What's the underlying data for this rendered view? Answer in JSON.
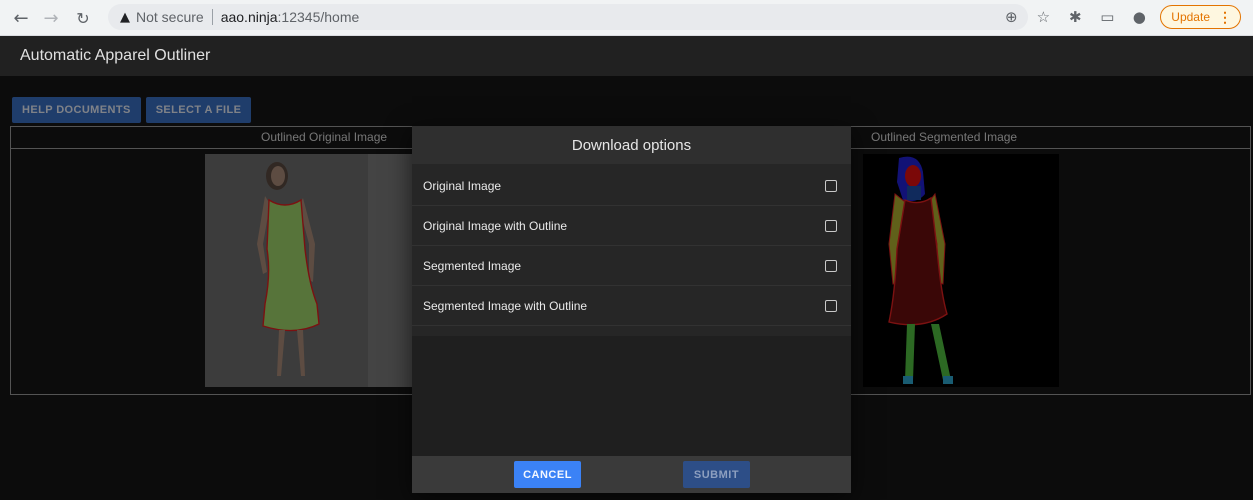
{
  "browser": {
    "security_label": "Not secure",
    "url_host": "aao.ninja",
    "url_path": ":12345/home",
    "update_label": "Update",
    "icons": [
      "back-arrow-icon",
      "forward-arrow-icon",
      "reload-icon",
      "warning-icon",
      "zoom-icon",
      "star-icon",
      "extensions-icon",
      "cast-icon",
      "profile-icon",
      "menu-dots-icon"
    ]
  },
  "app": {
    "title": "Automatic Apparel Outliner"
  },
  "toolbar": {
    "help_label": "HELP DOCUMENTS",
    "select_label": "SELECT A FILE"
  },
  "table": {
    "col_left": "Outlined Original Image",
    "col_right": "Outlined Segmented Image"
  },
  "dialog": {
    "title": "Download options",
    "options": [
      {
        "label": "Original Image",
        "checked": false
      },
      {
        "label": "Original Image with Outline",
        "checked": false
      },
      {
        "label": "Segmented Image",
        "checked": false
      },
      {
        "label": "Segmented Image with Outline",
        "checked": false
      }
    ],
    "cancel_label": "CANCEL",
    "submit_label": "SUBMIT"
  },
  "colors": {
    "accent": "#3b82f6",
    "outline": "#e02020",
    "dress": "#9ed36a"
  }
}
